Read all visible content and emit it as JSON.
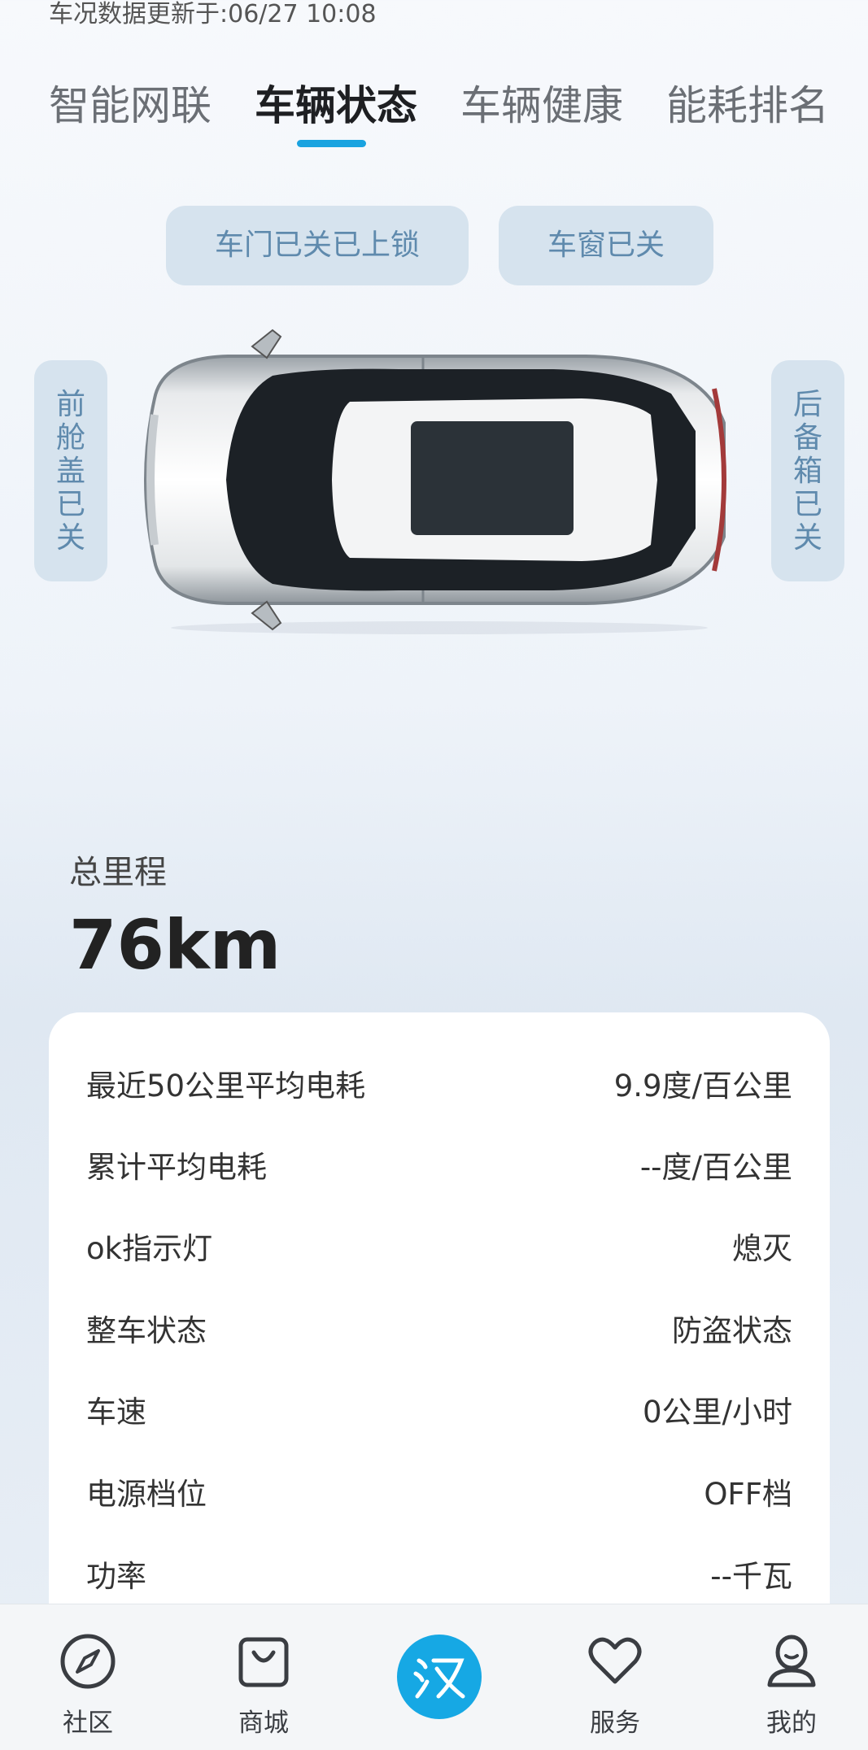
{
  "status_bar": {
    "update_text": "车况数据更新于:06/27 10:08"
  },
  "tabs": [
    {
      "label": "智能网联",
      "active": false
    },
    {
      "label": "车辆状态",
      "active": true
    },
    {
      "label": "车辆健康",
      "active": false
    },
    {
      "label": "能耗排名",
      "active": false
    }
  ],
  "status_pills": {
    "doors": "车门已关已上锁",
    "windows": "车窗已关",
    "hood": "前舱盖已关",
    "trunk": "后备箱已关"
  },
  "mileage": {
    "label": "总里程",
    "value": "76km"
  },
  "stats": [
    {
      "label": "最近50公里平均电耗",
      "value": "9.9度/百公里"
    },
    {
      "label": "累计平均电耗",
      "value": "--度/百公里"
    },
    {
      "label": "ok指示灯",
      "value": "熄灭"
    },
    {
      "label": "整车状态",
      "value": "防盗状态"
    },
    {
      "label": "车速",
      "value": "0公里/小时"
    },
    {
      "label": "电源档位",
      "value": "OFF档"
    },
    {
      "label": "功率",
      "value": "--千瓦"
    }
  ],
  "bottom_nav": [
    {
      "label": "社区",
      "icon": "compass-icon"
    },
    {
      "label": "商城",
      "icon": "shopping-bag-icon"
    },
    {
      "label": "",
      "icon": "han-logo-icon"
    },
    {
      "label": "服务",
      "icon": "heart-icon"
    },
    {
      "label": "我的",
      "icon": "profile-icon"
    }
  ],
  "colors": {
    "accent": "#1aa3e0",
    "pill_bg": "#d6e3ee",
    "pill_text": "#5f8aad"
  }
}
